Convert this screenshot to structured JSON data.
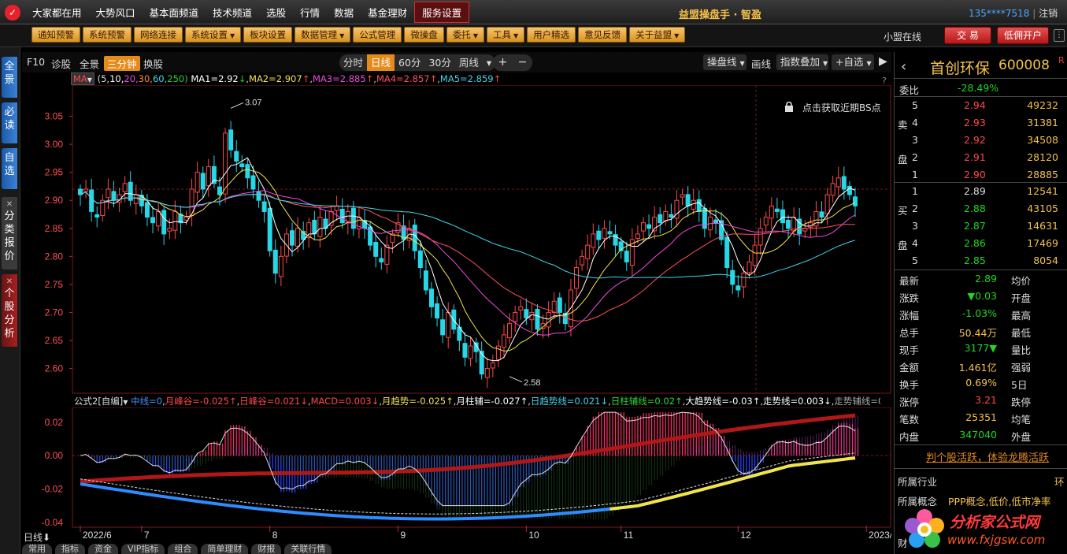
{
  "menubar": {
    "items": [
      "大家都在用",
      "大势风口",
      "基本面频道",
      "技术频道",
      "选股",
      "行情",
      "数据",
      "基金理财",
      "服务设置"
    ],
    "active": "服务设置",
    "brand": "益盟操盘手 · 智盈",
    "account": "135****7518",
    "logout": "注销"
  },
  "toolbar": {
    "items": [
      {
        "label": "通知预警",
        "dropdown": false
      },
      {
        "label": "系统预警",
        "dropdown": false
      },
      {
        "label": "网络连接",
        "dropdown": false
      },
      {
        "label": "系统设置",
        "dropdown": true
      },
      {
        "label": "板块设置",
        "dropdown": false
      },
      {
        "label": "数据管理",
        "dropdown": true
      },
      {
        "label": "公式管理",
        "dropdown": false
      },
      {
        "label": "微操盘",
        "dropdown": false
      },
      {
        "label": "委托",
        "dropdown": true
      },
      {
        "label": "工具",
        "dropdown": true
      },
      {
        "label": "用户精选",
        "dropdown": false
      },
      {
        "label": "意见反馈",
        "dropdown": false
      },
      {
        "label": "关于益盟",
        "dropdown": true
      }
    ],
    "online": "小盟在线",
    "trade": "交 易",
    "open_account": "低佣开户"
  },
  "sidebar": {
    "tabs": [
      "全景",
      "必读",
      "自选",
      "分类报价",
      "个股分析"
    ]
  },
  "chart_top": {
    "left": [
      "F10",
      "诊股",
      "全景",
      "三分钟",
      "换股"
    ],
    "selected": "三分钟",
    "periods": [
      "分时",
      "日线",
      "60分",
      "30分",
      "周线"
    ],
    "period_selected": "日线",
    "plus": "+",
    "minus": "−",
    "right": [
      "操盘线",
      "画线",
      "指数叠加",
      "+自选"
    ]
  },
  "ma_line": {
    "label": "MA",
    "params_prefix": "(5,",
    "params": [
      {
        "t": "10,",
        "c": "#ffffff"
      },
      {
        "t": "20,",
        "c": "#f04ae0"
      },
      {
        "t": "30,",
        "c": "#ff8a3a"
      },
      {
        "t": "60,",
        "c": "#41d5e8"
      },
      {
        "t": "250)",
        "c": "#30d530"
      }
    ],
    "values": [
      {
        "t": "MA1=2.92",
        "arrow": "↓",
        "c": "#ffffff",
        "ac": "#1fd81f"
      },
      {
        "t": "MA2=2.907",
        "arrow": "↑",
        "c": "#f3e34a",
        "ac": "#ff4848"
      },
      {
        "t": "MA3=2.885",
        "arrow": "↑",
        "c": "#f04ae0",
        "ac": "#ff4848"
      },
      {
        "t": "MA4=2.857",
        "arrow": "↑",
        "c": "#ff5060",
        "ac": "#ff4848"
      },
      {
        "t": "MA5=2.859",
        "arrow": "↑",
        "c": "#41d5e8",
        "ac": "#ff4848"
      }
    ],
    "help": "?"
  },
  "bs_hint": "点击获取近期BS点",
  "chart_data": {
    "type": "candlestick",
    "ylim": [
      2.56,
      3.1
    ],
    "y_ticks": [
      2.6,
      2.65,
      2.7,
      2.75,
      2.8,
      2.85,
      2.9,
      2.95,
      3.0,
      3.05
    ],
    "x_labels": [
      "2022/6",
      "7",
      "8",
      "9",
      "10",
      "11",
      "12",
      "2023/1",
      "2"
    ],
    "x_label_index": [
      0,
      11,
      34,
      57,
      80,
      97,
      118,
      141,
      157
    ],
    "annotations": [
      {
        "text": "3.07",
        "index": 27
      },
      {
        "text": "2.58",
        "index": 77
      }
    ],
    "up_color": "#ff4848",
    "down_color": "#26d7e8",
    "ma_colors": [
      "#ffffff",
      "#f3e34a",
      "#f04ae0",
      "#ff5060",
      "#41d5e8"
    ],
    "closes": [
      2.91,
      2.92,
      2.88,
      2.87,
      2.9,
      2.92,
      2.9,
      2.91,
      2.93,
      2.9,
      2.91,
      2.89,
      2.87,
      2.86,
      2.88,
      2.84,
      2.85,
      2.88,
      2.86,
      2.87,
      2.92,
      2.95,
      2.92,
      2.96,
      2.93,
      2.91,
      3.02,
      2.99,
      2.97,
      2.96,
      2.94,
      2.92,
      2.9,
      2.88,
      2.81,
      2.77,
      2.8,
      2.84,
      2.82,
      2.85,
      2.83,
      2.86,
      2.84,
      2.87,
      2.85,
      2.88,
      2.89,
      2.86,
      2.88,
      2.85,
      2.87,
      2.85,
      2.82,
      2.8,
      2.79,
      2.82,
      2.84,
      2.86,
      2.83,
      2.85,
      2.81,
      2.78,
      2.74,
      2.71,
      2.69,
      2.66,
      2.7,
      2.67,
      2.65,
      2.62,
      2.64,
      2.63,
      2.59,
      2.6,
      2.61,
      2.64,
      2.66,
      2.68,
      2.7,
      2.71,
      2.69,
      2.7,
      2.67,
      2.68,
      2.7,
      2.72,
      2.7,
      2.68,
      2.74,
      2.78,
      2.8,
      2.82,
      2.84,
      2.83,
      2.85,
      2.84,
      2.82,
      2.81,
      2.79,
      2.83,
      2.84,
      2.86,
      2.85,
      2.87,
      2.86,
      2.88,
      2.87,
      2.9,
      2.91,
      2.89,
      2.9,
      2.88,
      2.85,
      2.87,
      2.86,
      2.83,
      2.78,
      2.75,
      2.74,
      2.77,
      2.79,
      2.82,
      2.85,
      2.87,
      2.89,
      2.88,
      2.86,
      2.85,
      2.87,
      2.84,
      2.85,
      2.86,
      2.88,
      2.87,
      2.91,
      2.93,
      2.94,
      2.92,
      2.91,
      2.89
    ],
    "indicator": {
      "title": "公式2[自编]",
      "ylim": [
        -0.042,
        0.027
      ],
      "y_ticks": [
        0.02,
        0.0,
        -0.02,
        -0.04
      ]
    }
  },
  "indicator_line": [
    {
      "t": "中线=0",
      "c": "#4a8cff"
    },
    {
      "t": "月峰谷=-0.025↑",
      "c": "#ff4848"
    },
    {
      "t": "日峰谷=0.021↓",
      "c": "#ff4848"
    },
    {
      "t": "MACD=0.003↓",
      "c": "#ff4848"
    },
    {
      "t": "月趋势=-0.025↑",
      "c": "#f3e34a"
    },
    {
      "t": "月柱辅=-0.027↑",
      "c": "#ffffff"
    },
    {
      "t": "日趋势线=0.021↓",
      "c": "#41d5e8"
    },
    {
      "t": "日柱辅线=0.02↑",
      "c": "#30d530"
    },
    {
      "t": "大趋势线=-0.03↑",
      "c": "#ffffff"
    },
    {
      "t": "走势线=0.003↓",
      "c": "#ffffff"
    },
    {
      "t": "走势辅线=0.005↓",
      "c": "#aaaaaa"
    },
    {
      "t": "F=-",
      "c": "#ff4848"
    }
  ],
  "bottom": {
    "period": "日线",
    "tabs": [
      "常用",
      "指标",
      "资金",
      "VIP指标",
      "组合",
      "简单理财",
      "财报",
      "关联行情"
    ]
  },
  "quote": {
    "name": "首创环保",
    "code": "600008",
    "badge": "R",
    "weibi_label": "委比",
    "weibi": "-28.49%",
    "sell": [
      {
        "n": "5",
        "p": "2.94",
        "v": "49232"
      },
      {
        "n": "4",
        "p": "2.93",
        "v": "31381"
      },
      {
        "n": "3",
        "p": "2.92",
        "v": "34508"
      },
      {
        "n": "2",
        "p": "2.91",
        "v": "28120"
      },
      {
        "n": "1",
        "p": "2.90",
        "v": "28885"
      }
    ],
    "buy": [
      {
        "n": "1",
        "p": "2.89",
        "v": "12541"
      },
      {
        "n": "2",
        "p": "2.88",
        "v": "43105"
      },
      {
        "n": "3",
        "p": "2.87",
        "v": "14631"
      },
      {
        "n": "4",
        "p": "2.86",
        "v": "17469"
      },
      {
        "n": "5",
        "p": "2.85",
        "v": "8054"
      }
    ],
    "sell_label": [
      "卖",
      "盘"
    ],
    "buy_label": [
      "买",
      "盘"
    ],
    "stats": [
      {
        "l": "最新",
        "v": "2.89",
        "c": "dn",
        "r": "均价"
      },
      {
        "l": "涨跌",
        "v": "▼0.03",
        "c": "dn",
        "r": "开盘"
      },
      {
        "l": "涨幅",
        "v": "-1.03%",
        "c": "dn",
        "r": "最高"
      },
      {
        "l": "总手",
        "v": "50.44万",
        "c": "ye",
        "r": "最低"
      },
      {
        "l": "现手",
        "v": "3177▼",
        "c": "dn",
        "r": "量比"
      },
      {
        "l": "金额",
        "v": "1.461亿",
        "c": "ye",
        "r": "强弱"
      },
      {
        "l": "换手",
        "v": "0.69%",
        "c": "ye",
        "r": "5日"
      },
      {
        "l": "涨停",
        "v": "3.21",
        "c": "up",
        "r": "跌停"
      },
      {
        "l": "笔数",
        "v": "25351",
        "c": "ye",
        "r": "均笔"
      },
      {
        "l": "内盘",
        "v": "347040",
        "c": "dn",
        "r": "外盘"
      }
    ],
    "promo": "判个股活跃，体验龙腾活跃",
    "industry_label": "所属行业",
    "industry": "环",
    "concept_label": "所属概念",
    "concept": "PPP概念,低价,低市净率",
    "last_label": "财"
  },
  "watermark": {
    "text": "分析家公式网",
    "url": "www.fxjgsw.com"
  }
}
